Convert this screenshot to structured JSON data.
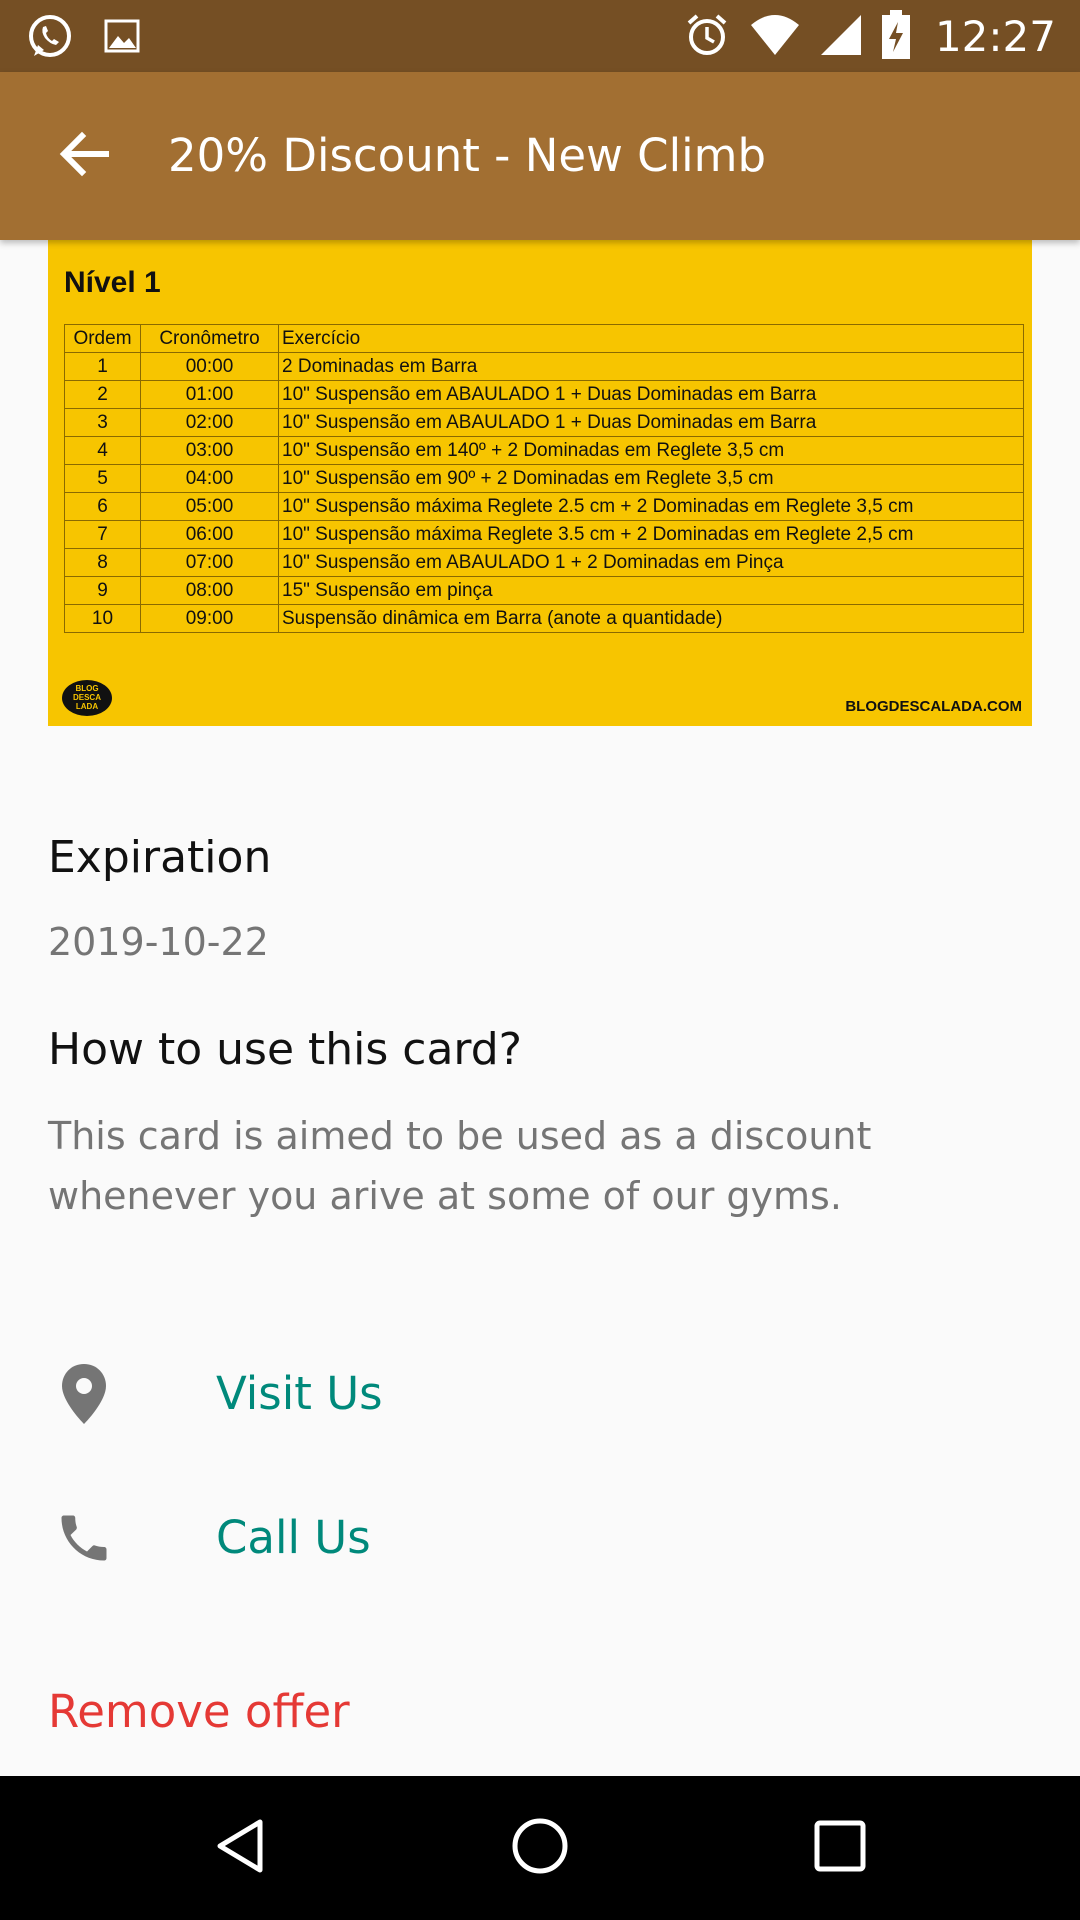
{
  "status_bar": {
    "time": "12:27",
    "left_icons": [
      "whatsapp-icon",
      "image-icon"
    ],
    "right_icons": [
      "alarm-icon",
      "wifi-icon",
      "signal-icon",
      "battery-charging-icon"
    ]
  },
  "app_bar": {
    "title": "20% Discount - New Climb",
    "back_icon": "arrow-back-icon",
    "color": "#a26f32"
  },
  "image": {
    "title": "Nível 1",
    "headers": [
      "Ordem",
      "Cronômetro",
      "Exercício"
    ],
    "rows": [
      [
        "1",
        "00:00",
        "2 Dominadas em Barra"
      ],
      [
        "2",
        "01:00",
        "10\" Suspensão em ABAULADO 1 + Duas Dominadas em Barra"
      ],
      [
        "3",
        "02:00",
        "10\" Suspensão em ABAULADO 1 + Duas Dominadas em Barra"
      ],
      [
        "4",
        "03:00",
        "10\" Suspensão em 140º + 2 Dominadas em Reglete 3,5 cm"
      ],
      [
        "5",
        "04:00",
        "10\" Suspensão em 90º + 2 Dominadas em Reglete 3,5 cm"
      ],
      [
        "6",
        "05:00",
        "10\" Suspensão máxima Reglete 2.5 cm + 2 Dominadas em Reglete 3,5 cm"
      ],
      [
        "7",
        "06:00",
        "10\" Suspensão máxima Reglete 3.5 cm + 2 Dominadas em Reglete 2,5 cm"
      ],
      [
        "8",
        "07:00",
        "10\" Suspensão em ABAULADO 1 + 2 Dominadas em Pinça"
      ],
      [
        "9",
        "08:00",
        "15\" Suspensão em pinça"
      ],
      [
        "10",
        "09:00",
        "Suspensão dinâmica em Barra (anote a quantidade)"
      ]
    ],
    "logo_text": "BLOG DESCA LADA",
    "site": "BLOGDESCALADA.COM",
    "background": "#f7c500"
  },
  "expiration": {
    "label": "Expiration",
    "value": "2019-10-22"
  },
  "how_to": {
    "label": "How to use this card?",
    "value": "This card is aimed to be used as a discount whenever you arive at some of our gyms."
  },
  "actions": {
    "visit": {
      "label": "Visit Us",
      "icon": "location-pin-icon"
    },
    "call": {
      "label": "Call Us",
      "icon": "phone-icon"
    },
    "accent": "#00897b"
  },
  "remove": {
    "label": "Remove offer",
    "color": "#e53935"
  },
  "nav_bar": {
    "icons": [
      "back-triangle-icon",
      "home-circle-icon",
      "recents-square-icon"
    ]
  }
}
